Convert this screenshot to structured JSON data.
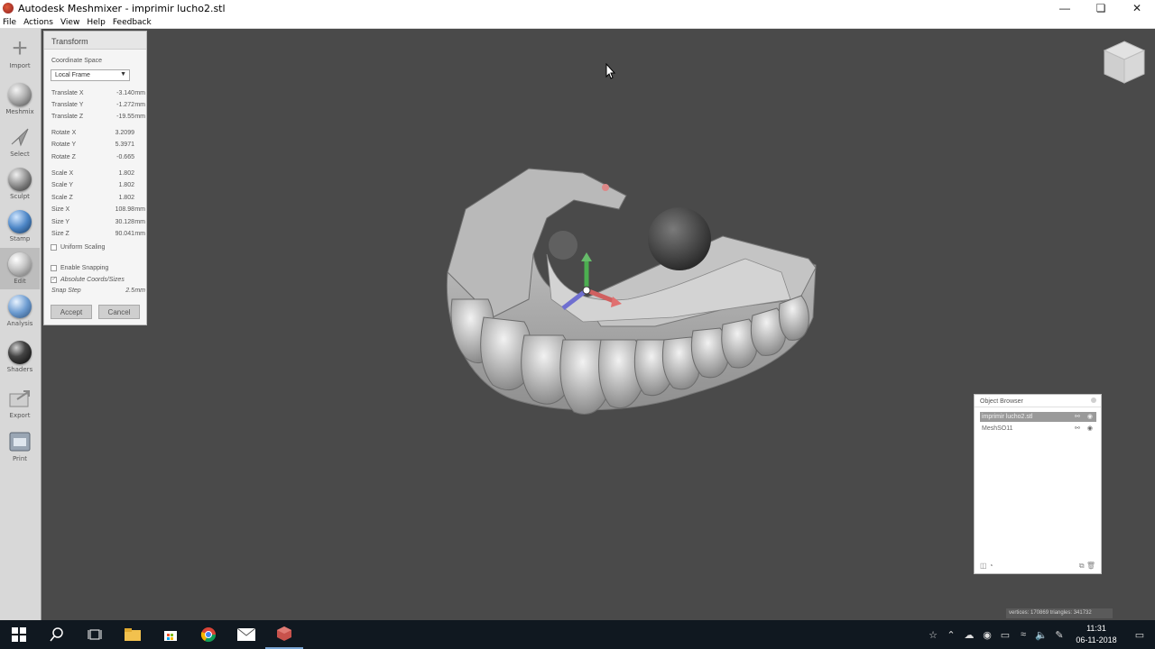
{
  "window": {
    "title": "Autodesk Meshmixer - imprimir lucho2.stl"
  },
  "menu": [
    "File",
    "Actions",
    "View",
    "Help",
    "Feedback"
  ],
  "tools": [
    {
      "label": "Import",
      "icon": "plus-icon"
    },
    {
      "label": "Meshmix",
      "icon": "meshmix-icon"
    },
    {
      "label": "Select",
      "icon": "select-arrow-icon"
    },
    {
      "label": "Sculpt",
      "icon": "sculpt-brush-icon"
    },
    {
      "label": "Stamp",
      "icon": "stamp-icon"
    },
    {
      "label": "Edit",
      "icon": "edit-icon"
    },
    {
      "label": "Analysis",
      "icon": "analysis-icon"
    },
    {
      "label": "Shaders",
      "icon": "shaders-icon"
    },
    {
      "label": "Export",
      "icon": "export-icon"
    },
    {
      "label": "Print",
      "icon": "print-icon"
    }
  ],
  "transform": {
    "title": "Transform",
    "coord_label": "Coordinate Space",
    "coord_value": "Local Frame",
    "rows": [
      {
        "label": "Translate X",
        "value": "-3.140",
        "unit": "mm"
      },
      {
        "label": "Translate Y",
        "value": "-1.272",
        "unit": "mm"
      },
      {
        "label": "Translate Z",
        "value": "-19.55",
        "unit": "mm"
      },
      {
        "label": "Rotate X",
        "value": "3.2099",
        "unit": ""
      },
      {
        "label": "Rotate Y",
        "value": "5.3971",
        "unit": ""
      },
      {
        "label": "Rotate Z",
        "value": "-0.665",
        "unit": ""
      },
      {
        "label": "Scale X",
        "value": "1.802",
        "unit": ""
      },
      {
        "label": "Scale Y",
        "value": "1.802",
        "unit": ""
      },
      {
        "label": "Scale Z",
        "value": "1.802",
        "unit": ""
      },
      {
        "label": "Size X",
        "value": "108.98",
        "unit": "mm"
      },
      {
        "label": "Size Y",
        "value": "30.128",
        "unit": "mm"
      },
      {
        "label": "Size Z",
        "value": "90.041",
        "unit": "mm"
      }
    ],
    "uniform_scaling": "Uniform Scaling",
    "enable_snapping": "Enable Snapping",
    "absolute_coords": "Absolute Coords/Sizes",
    "snap_step_label": "Snap Step",
    "snap_step_value": "2.5",
    "snap_step_unit": "mm",
    "accept": "Accept",
    "cancel": "Cancel"
  },
  "object_browser": {
    "title": "Object Browser",
    "items": [
      {
        "name": "imprimir lucho2.stl",
        "selected": true
      },
      {
        "name": "MeshSO11",
        "selected": false
      }
    ]
  },
  "stats": "vertices: 170869  triangles: 341732",
  "clock": {
    "time": "11:31",
    "date": "06-11-2018"
  }
}
